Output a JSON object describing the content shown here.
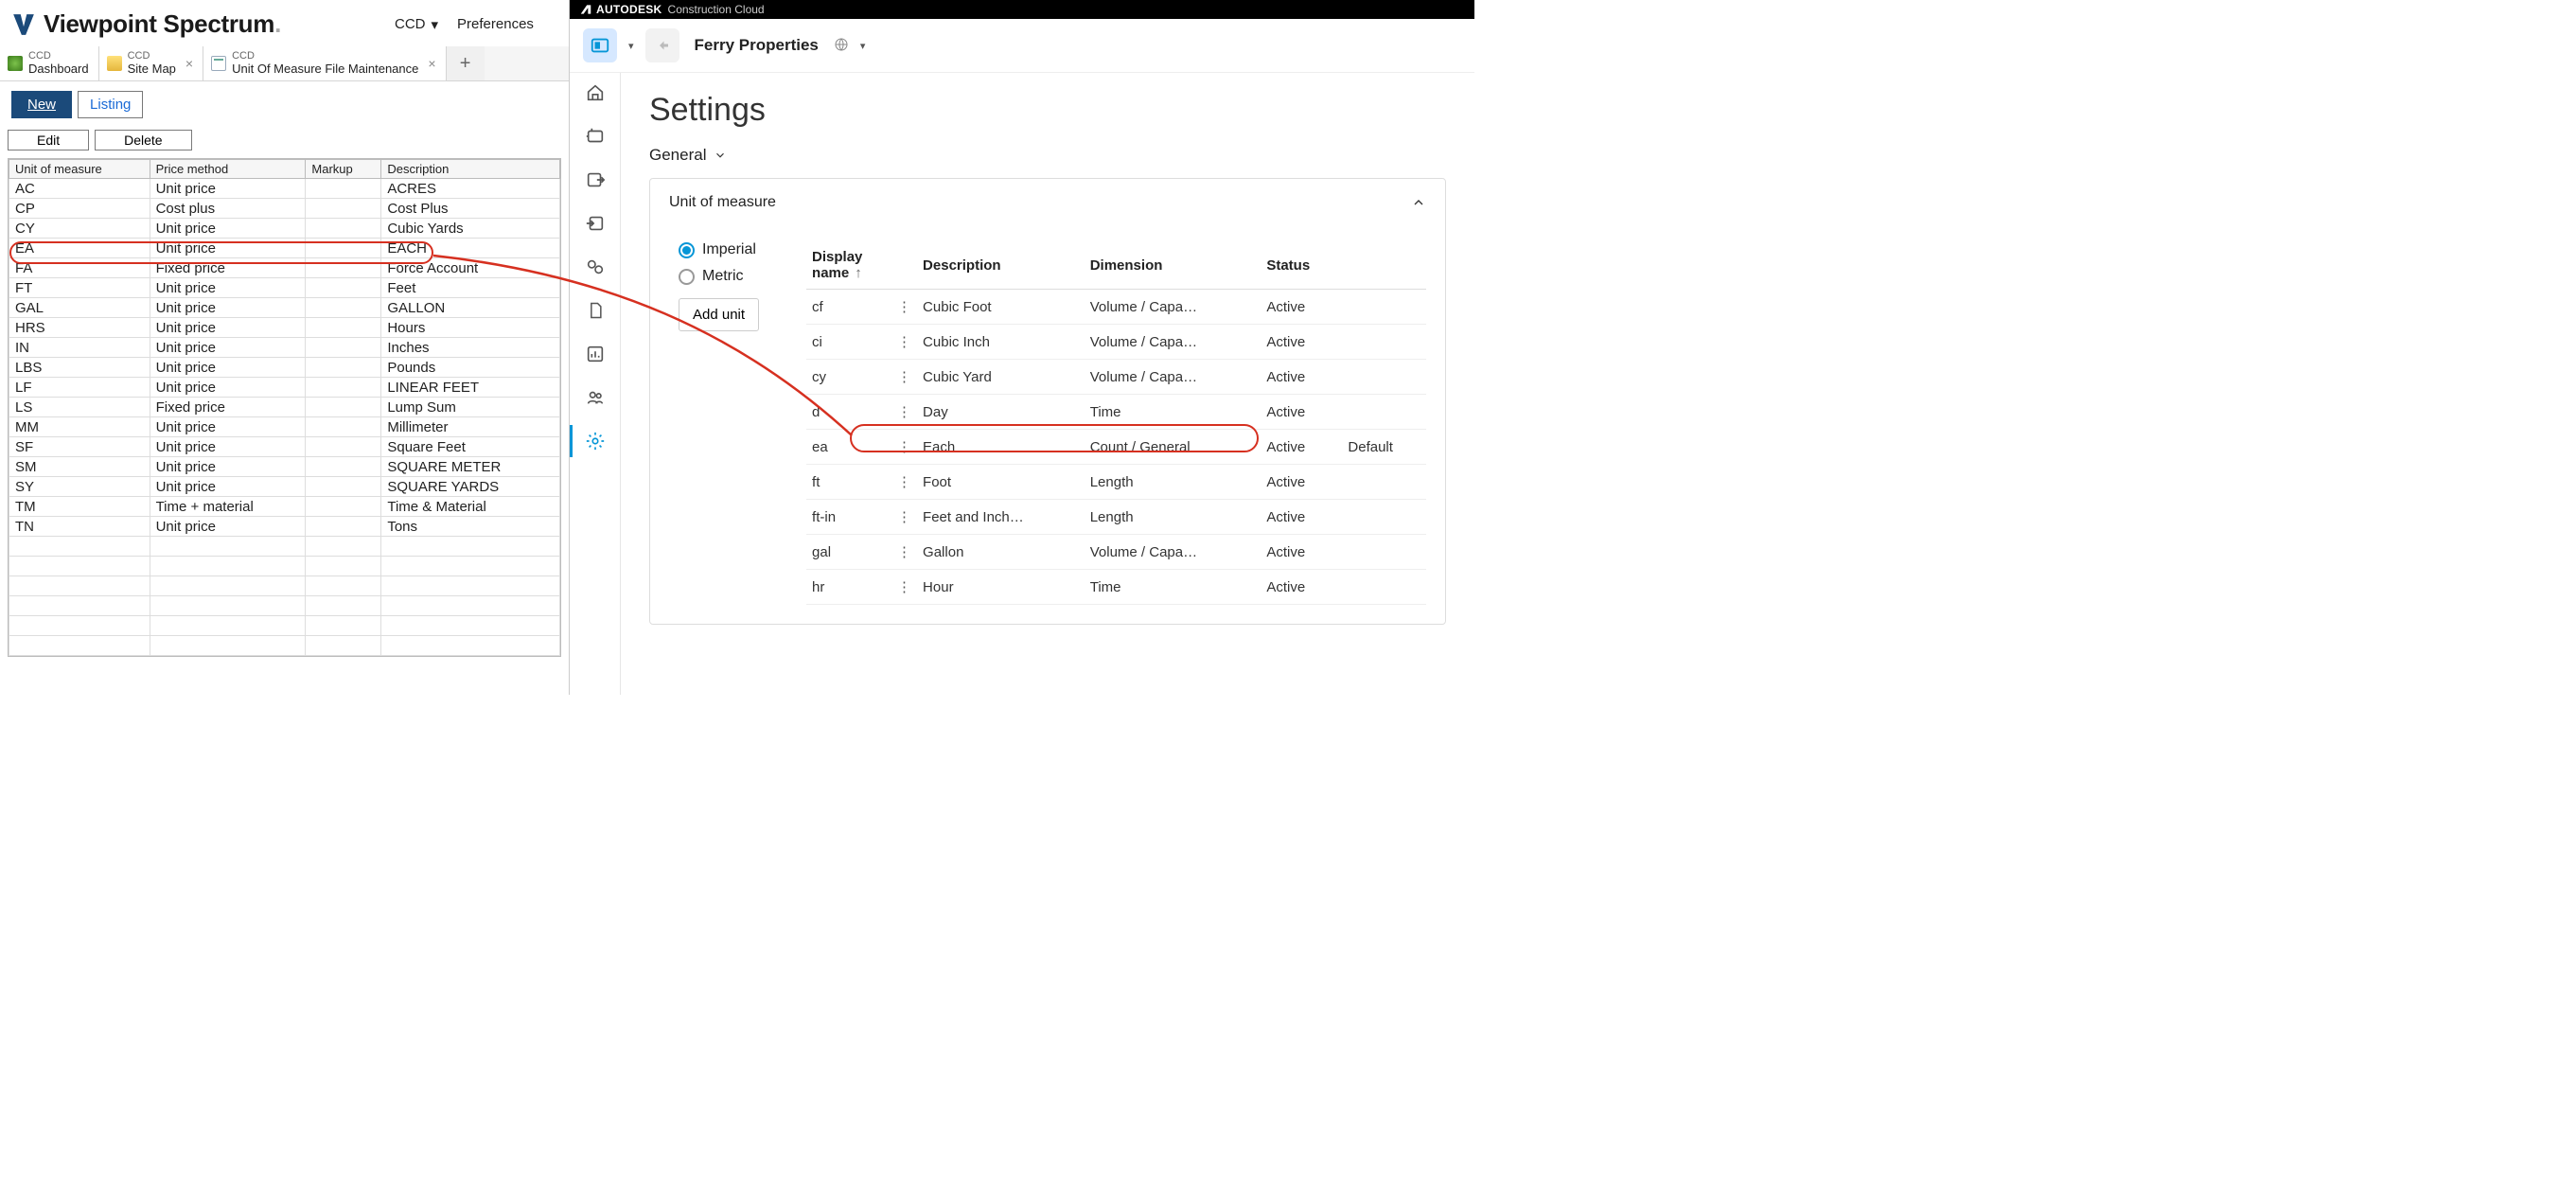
{
  "viewpoint": {
    "brand1": "Viewpoint",
    "brand2": "Spectrum",
    "dropdown": "CCD",
    "preferences": "Preferences",
    "tabs": [
      {
        "top": "CCD",
        "bottom": "Dashboard",
        "closable": false,
        "icon": "green"
      },
      {
        "top": "CCD",
        "bottom": "Site Map",
        "closable": true,
        "icon": "folder"
      },
      {
        "top": "CCD",
        "bottom": "Unit Of Measure File Maintenance",
        "closable": true,
        "icon": "doc"
      }
    ],
    "buttons": {
      "new": "New",
      "listing": "Listing",
      "edit": "Edit",
      "delete": "Delete"
    },
    "grid_headers": [
      "Unit of measure",
      "Price method",
      "Markup",
      "Description"
    ],
    "grid_rows": [
      [
        "AC",
        "Unit price",
        "",
        "ACRES"
      ],
      [
        "CP",
        "Cost plus",
        "",
        "Cost Plus"
      ],
      [
        "CY",
        "Unit price",
        "",
        "Cubic Yards"
      ],
      [
        "EA",
        "Unit price",
        "",
        "EACH"
      ],
      [
        "FA",
        "Fixed price",
        "",
        "Force Account"
      ],
      [
        "FT",
        "Unit price",
        "",
        "Feet"
      ],
      [
        "GAL",
        "Unit price",
        "",
        "GALLON"
      ],
      [
        "HRS",
        "Unit price",
        "",
        "Hours"
      ],
      [
        "IN",
        "Unit price",
        "",
        "Inches"
      ],
      [
        "LBS",
        "Unit price",
        "",
        "Pounds"
      ],
      [
        "LF",
        "Unit price",
        "",
        "LINEAR FEET"
      ],
      [
        "LS",
        "Fixed price",
        "",
        "Lump Sum"
      ],
      [
        "MM",
        "Unit price",
        "",
        "Millimeter"
      ],
      [
        "SF",
        "Unit price",
        "",
        "Square Feet"
      ],
      [
        "SM",
        "Unit price",
        "",
        "SQUARE METER"
      ],
      [
        "SY",
        "Unit price",
        "",
        "SQUARE YARDS"
      ],
      [
        "TM",
        "Time + material",
        "",
        "Time & Material"
      ],
      [
        "TN",
        "Unit price",
        "",
        "Tons"
      ]
    ],
    "empty_rows": 6
  },
  "autodesk": {
    "topbar_brand": "AUTODESK",
    "topbar_product": "Construction Cloud",
    "project": "Ferry Properties",
    "page_title": "Settings",
    "crumb": "General",
    "card_title": "Unit of measure",
    "radios": [
      {
        "label": "Imperial",
        "checked": true
      },
      {
        "label": "Metric",
        "checked": false
      }
    ],
    "add_unit": "Add unit",
    "table_headers": [
      "Display name",
      "",
      "Description",
      "Dimension",
      "Status",
      ""
    ],
    "table_rows": [
      [
        "cf",
        "⋮",
        "Cubic Foot",
        "Volume / Capa…",
        "Active",
        ""
      ],
      [
        "ci",
        "⋮",
        "Cubic Inch",
        "Volume / Capa…",
        "Active",
        ""
      ],
      [
        "cy",
        "⋮",
        "Cubic Yard",
        "Volume / Capa…",
        "Active",
        ""
      ],
      [
        "d",
        "⋮",
        "Day",
        "Time",
        "Active",
        ""
      ],
      [
        "ea",
        "⋮",
        "Each",
        "Count / General",
        "Active",
        "Default"
      ],
      [
        "ft",
        "⋮",
        "Foot",
        "Length",
        "Active",
        ""
      ],
      [
        "ft-in",
        "⋮",
        "Feet and Inch…",
        "Length",
        "Active",
        ""
      ],
      [
        "gal",
        "⋮",
        "Gallon",
        "Volume / Capa…",
        "Active",
        ""
      ],
      [
        "hr",
        "⋮",
        "Hour",
        "Time",
        "Active",
        ""
      ]
    ]
  }
}
